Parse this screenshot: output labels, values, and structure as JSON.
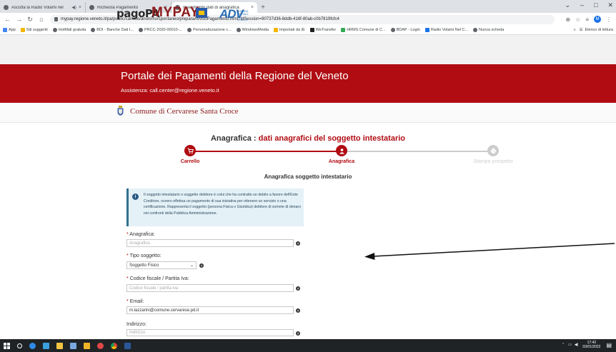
{
  "browser": {
    "tabs": [
      {
        "label": "Ascolta la Radio Volami nel",
        "active": false
      },
      {
        "label": "Richiesta Pagamento",
        "active": false
      },
      {
        "label": "Inserimento dati di anagrafica",
        "active": true
      }
    ],
    "new_tab_symbol": "+",
    "url": "mypay.regione.veneto.it/pa/public/carrello/anonimo/spontaneo/preparaAvvisoPagamento.html?idSession=90737d36-8ddb-416f-80ab-c0b7819fcfc4",
    "profile_initial": "M",
    "bookmarks": [
      {
        "label": "App",
        "color": "#4285f4"
      },
      {
        "label": "Siti suggeriti",
        "color": "#f4b400"
      },
      {
        "label": "HotMail gratuita",
        "color": "#5f6368"
      },
      {
        "label": "BDI - Banche Dati I...",
        "color": "#5f6368"
      },
      {
        "label": "PRCC-2020-00010-...",
        "color": "#5f6368"
      },
      {
        "label": "Personalizzazione c...",
        "color": "#5f6368"
      },
      {
        "label": "WindowsMedia",
        "color": "#5f6368"
      },
      {
        "label": "Importati da IE",
        "color": "#f4b400"
      },
      {
        "label": "WeTransfer",
        "color": "#202124"
      },
      {
        "label": "HRMS Comune di C...",
        "color": "#34a853"
      },
      {
        "label": "BDAP - Login",
        "color": "#5f6368"
      },
      {
        "label": "Radio Volami Nel C...",
        "color": "#1a73e8"
      },
      {
        "label": "Nuova scheda",
        "color": "#5f6368"
      }
    ],
    "reading_list": "Elenco di lettura"
  },
  "header": {
    "logo_pagopa": "pagoPA",
    "logo_mypay": "MYPAY",
    "logo_adv": "ADV",
    "logo_adv_sub": "AGENZIA DIGITALE DEL VENETO",
    "portal_title": "Portale dei Pagamenti della Regione del Veneto",
    "assistance": "Assistenza: call.center@regione.veneto.it",
    "comune": "Comune di Cervarese Santa Croce"
  },
  "page": {
    "heading_main": "Anagrafica",
    "heading_sep": " : ",
    "heading_detail": "dati anagrafici del soggetto intestatario",
    "steps": [
      {
        "label": "Carrello",
        "state": "done"
      },
      {
        "label": "Anagrafica",
        "state": "current"
      },
      {
        "label": "Stampa prospetto",
        "state": "todo"
      }
    ],
    "subheading": "Anagrafica soggetto intestatario",
    "info_text": "Il soggetto intestatario o soggetto debitore è colui che ha contratto un debito a favore dell'Ente Creditore, ovvero effettua un pagamento di sua iniziativa per ottenere un servizio o una certificazione. Rappresenta il soggetto (persona Fisica o Giuridica) debitore di somme di denaro nei confronti della Pubblica Amministrazione.",
    "fields": {
      "anagrafica": {
        "label": "Anagrafica:",
        "placeholder": "Anagrafica",
        "value": ""
      },
      "tipo_soggetto": {
        "label": "Tipo soggetto:",
        "value": "Soggetto Fisico"
      },
      "codice_fiscale": {
        "label": "Codice fiscale / Partita Iva:",
        "placeholder": "Codice fiscale / partita iva",
        "value": ""
      },
      "email": {
        "label": "Email:",
        "value": "m.lazzarini@comune.cervarese.pd.it"
      },
      "indirizzo": {
        "label": "Indirizzo:",
        "placeholder": "Indirizzo",
        "value": ""
      }
    },
    "required_mark": "*",
    "help_symbol": "?"
  },
  "taskbar": {
    "time": "17:42",
    "date": "03/01/2022"
  },
  "colors": {
    "brand_red": "#b00c12",
    "info_bg": "#e4f1f7",
    "step_done": "#b00c12",
    "step_todo": "#cccccc"
  }
}
